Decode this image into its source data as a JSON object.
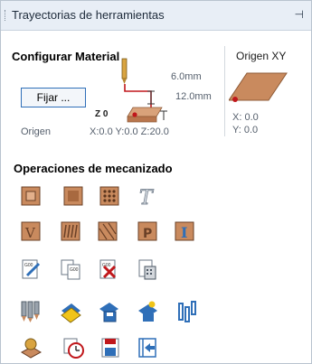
{
  "panel": {
    "title": "Trayectorias de herramientas",
    "pin_glyph": "⊣"
  },
  "material": {
    "heading": "Configurar Material",
    "button_label": "Fijar ...",
    "thickness": "6.0mm",
    "depth": "12.0mm",
    "z_label": "Z 0",
    "origin_label": "Origen",
    "origin_coords": "X:0.0 Y:0.0 Z:20.0"
  },
  "xy_origin": {
    "heading": "Origen XY",
    "x": "X: 0.0",
    "y": "Y: 0.0"
  },
  "operations": {
    "heading": "Operaciones de mecanizado",
    "rows": [
      [
        "profile-toolpath-icon",
        "pocket-toolpath-icon",
        "drilling-toolpath-icon",
        "texture-toolpath-icon"
      ],
      [
        "vcarve-toolpath-icon",
        "fluting-toolpath-icon",
        "prism-toolpath-icon",
        "quick-engrave-icon",
        "inlay-toolpath-icon"
      ],
      [
        "edit-toolpath-icon",
        "copy-toolpath-icon",
        "delete-toolpath-icon",
        "calculator-icon"
      ],
      [
        "tool-database-icon",
        "material-setup-icon",
        "save-toolpath-icon",
        "merge-toolpath-icon",
        "toolpath-template-icon"
      ],
      [
        "preview-material-icon",
        "time-estimate-icon",
        "save-gcode-icon",
        "import-toolpath-icon"
      ]
    ]
  },
  "colors": {
    "wood": "#c98a5e",
    "wood_dark": "#8e5a36",
    "accent_blue": "#2f6fb8",
    "red": "#c0171b"
  }
}
